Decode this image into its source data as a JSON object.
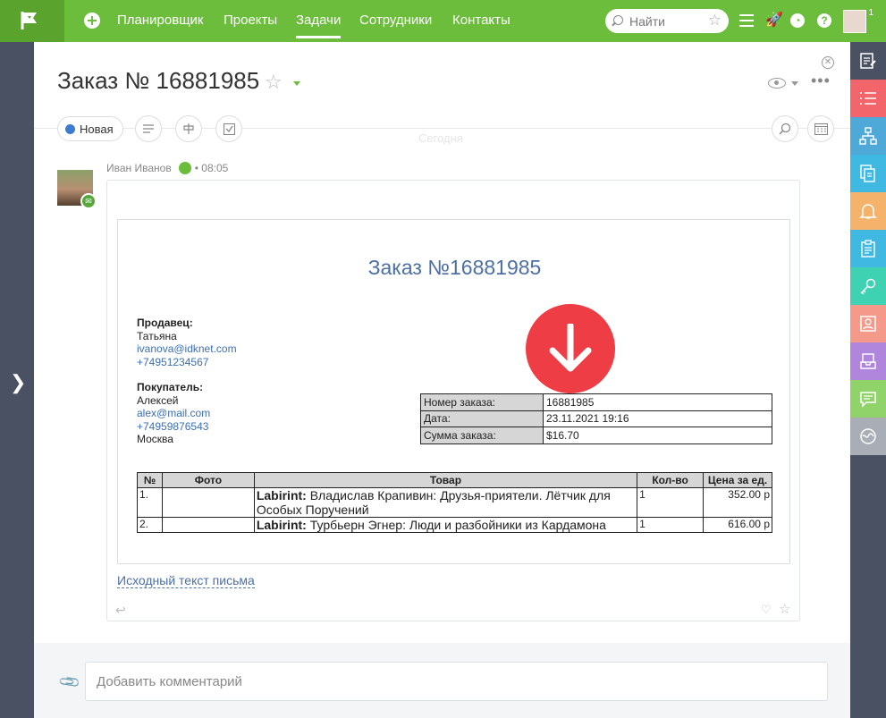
{
  "topbar": {
    "nav": [
      "Планировщик",
      "Проекты",
      "Задачи",
      "Сотрудники",
      "Контакты"
    ],
    "active_nav": "Задачи",
    "search_placeholder": "Найти",
    "notifications_count": "1",
    "accent_color": "#6bbd3b"
  },
  "task": {
    "title": "Заказ № 16881985",
    "status": "Новая",
    "timeline_label": "Сегодня"
  },
  "message": {
    "author": "Иван Иванов",
    "time": "08:05",
    "email": {
      "title": "Заказ №16881985",
      "seller_label": "Продавец:",
      "seller_name": "Татьяна",
      "seller_email": "ivanova@idknet.com",
      "seller_phone": "+74951234567",
      "buyer_label": "Покупатель:",
      "buyer_name": "Алексей",
      "buyer_email": "alex@mail.com",
      "buyer_phone": "+74959876543",
      "buyer_city": "Москва",
      "order_info": [
        {
          "key": "Номер заказа:",
          "value": "16881985"
        },
        {
          "key": "Дата:",
          "value": "23.11.2021 19:16"
        },
        {
          "key": "Сумма заказа:",
          "value": "$16.70"
        }
      ],
      "items_headers": [
        "№",
        "Фото",
        "Товар",
        "Кол-во",
        "Цена за ед."
      ],
      "items": [
        {
          "num": "1.",
          "publisher": "Labirint:",
          "name": "Владислав Крапивин: Друзья-приятели. Лётчик для Особых Поручений",
          "qty": "1",
          "price": "352.00 р"
        },
        {
          "num": "2.",
          "publisher": "Labirint:",
          "name": "Турбьерн Эгнер: Люди и разбойники из Кардамона",
          "qty": "1",
          "price": "616.00 р"
        }
      ]
    },
    "source_link": "Исходный текст письма"
  },
  "comment": {
    "placeholder": "Добавить комментарий"
  },
  "right_rail": [
    {
      "icon": "edit-icon",
      "color": "#4a5163"
    },
    {
      "icon": "list-icon",
      "color": "#f2656a"
    },
    {
      "icon": "hierarchy-icon",
      "color": "#4ea8d8"
    },
    {
      "icon": "documents-icon",
      "color": "#3fb8e2"
    },
    {
      "icon": "bell-icon",
      "color": "#f5b26b"
    },
    {
      "icon": "clipboard-icon",
      "color": "#3fb8e2"
    },
    {
      "icon": "key-icon",
      "color": "#3ed1b2"
    },
    {
      "icon": "contact-card-icon",
      "color": "#f59a8b"
    },
    {
      "icon": "inbox-icon",
      "color": "#b086dc"
    },
    {
      "icon": "chat-icon",
      "color": "#8fd36a"
    },
    {
      "icon": "activity-icon",
      "color": "#a9aeb6"
    }
  ]
}
